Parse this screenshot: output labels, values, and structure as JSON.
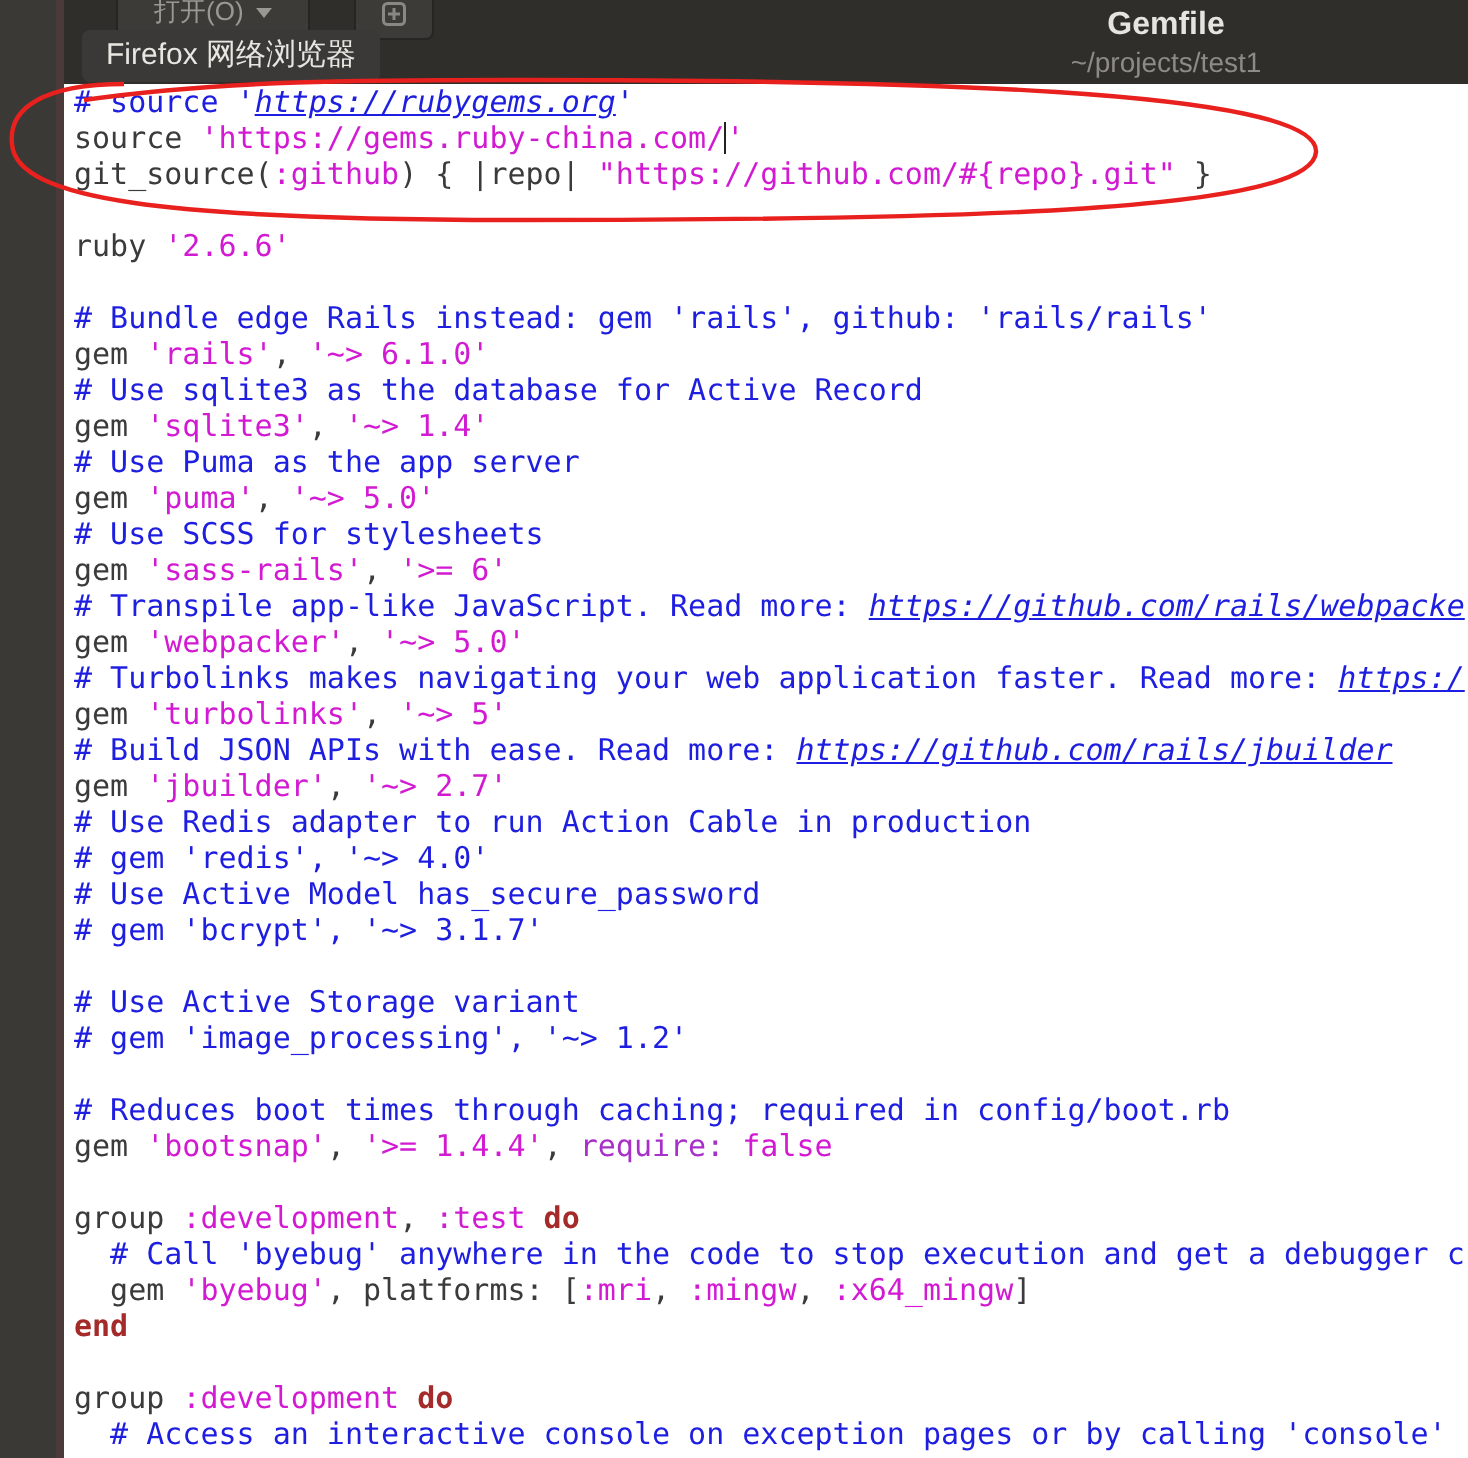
{
  "header": {
    "open_button": "打开(O)",
    "title": "Gemfile",
    "subtitle": "~/projects/test1"
  },
  "tooltip": "Firefox 网络浏览器",
  "lines": [
    {
      "kind": "code",
      "tokens": [
        {
          "kind": "comment",
          "text": "# source '"
        },
        {
          "kind": "link",
          "text": "https://rubygems.org"
        },
        {
          "kind": "comment",
          "text": "'"
        }
      ]
    },
    {
      "kind": "code",
      "tokens": [
        {
          "kind": "plain",
          "text": "source "
        },
        {
          "kind": "string",
          "text": "'https://gems.ruby-china.com/"
        },
        {
          "kind": "cursor"
        },
        {
          "kind": "string",
          "text": "'"
        }
      ]
    },
    {
      "kind": "code",
      "tokens": [
        {
          "kind": "plain",
          "text": "git_source("
        },
        {
          "kind": "symbol",
          "text": ":github"
        },
        {
          "kind": "plain",
          "text": ") { |repo| "
        },
        {
          "kind": "string",
          "text": "\"https://github.com/#{repo}.git\""
        },
        {
          "kind": "plain",
          "text": " }"
        }
      ]
    },
    {
      "kind": "blank"
    },
    {
      "kind": "code",
      "tokens": [
        {
          "kind": "plain",
          "text": "ruby "
        },
        {
          "kind": "string",
          "text": "'2.6.6'"
        }
      ]
    },
    {
      "kind": "blank"
    },
    {
      "kind": "code",
      "tokens": [
        {
          "kind": "comment",
          "text": "# Bundle edge Rails instead: gem 'rails', github: 'rails/rails'"
        }
      ]
    },
    {
      "kind": "code",
      "tokens": [
        {
          "kind": "plain",
          "text": "gem "
        },
        {
          "kind": "string",
          "text": "'rails'"
        },
        {
          "kind": "plain",
          "text": ", "
        },
        {
          "kind": "string",
          "text": "'~> 6.1.0'"
        }
      ]
    },
    {
      "kind": "code",
      "tokens": [
        {
          "kind": "comment",
          "text": "# Use sqlite3 as the database for Active Record"
        }
      ]
    },
    {
      "kind": "code",
      "tokens": [
        {
          "kind": "plain",
          "text": "gem "
        },
        {
          "kind": "string",
          "text": "'sqlite3'"
        },
        {
          "kind": "plain",
          "text": ", "
        },
        {
          "kind": "string",
          "text": "'~> 1.4'"
        }
      ]
    },
    {
      "kind": "code",
      "tokens": [
        {
          "kind": "comment",
          "text": "# Use Puma as the app server"
        }
      ]
    },
    {
      "kind": "code",
      "tokens": [
        {
          "kind": "plain",
          "text": "gem "
        },
        {
          "kind": "string",
          "text": "'puma'"
        },
        {
          "kind": "plain",
          "text": ", "
        },
        {
          "kind": "string",
          "text": "'~> 5.0'"
        }
      ]
    },
    {
      "kind": "code",
      "tokens": [
        {
          "kind": "comment",
          "text": "# Use SCSS for stylesheets"
        }
      ]
    },
    {
      "kind": "code",
      "tokens": [
        {
          "kind": "plain",
          "text": "gem "
        },
        {
          "kind": "string",
          "text": "'sass-rails'"
        },
        {
          "kind": "plain",
          "text": ", "
        },
        {
          "kind": "string",
          "text": "'>= 6'"
        }
      ]
    },
    {
      "kind": "code",
      "tokens": [
        {
          "kind": "comment",
          "text": "# Transpile app-like JavaScript. Read more: "
        },
        {
          "kind": "link",
          "text": "https://github.com/rails/webpacke"
        }
      ]
    },
    {
      "kind": "code",
      "tokens": [
        {
          "kind": "plain",
          "text": "gem "
        },
        {
          "kind": "string",
          "text": "'webpacker'"
        },
        {
          "kind": "plain",
          "text": ", "
        },
        {
          "kind": "string",
          "text": "'~> 5.0'"
        }
      ]
    },
    {
      "kind": "code",
      "tokens": [
        {
          "kind": "comment",
          "text": "# Turbolinks makes navigating your web application faster. Read more: "
        },
        {
          "kind": "link",
          "text": "https:/"
        }
      ]
    },
    {
      "kind": "code",
      "tokens": [
        {
          "kind": "plain",
          "text": "gem "
        },
        {
          "kind": "string",
          "text": "'turbolinks'"
        },
        {
          "kind": "plain",
          "text": ", "
        },
        {
          "kind": "string",
          "text": "'~> 5'"
        }
      ]
    },
    {
      "kind": "code",
      "tokens": [
        {
          "kind": "comment",
          "text": "# Build JSON APIs with ease. Read more: "
        },
        {
          "kind": "link",
          "text": "https://github.com/rails/jbuilder"
        }
      ]
    },
    {
      "kind": "code",
      "tokens": [
        {
          "kind": "plain",
          "text": "gem "
        },
        {
          "kind": "string",
          "text": "'jbuilder'"
        },
        {
          "kind": "plain",
          "text": ", "
        },
        {
          "kind": "string",
          "text": "'~> 2.7'"
        }
      ]
    },
    {
      "kind": "code",
      "tokens": [
        {
          "kind": "comment",
          "text": "# Use Redis adapter to run Action Cable in production"
        }
      ]
    },
    {
      "kind": "code",
      "tokens": [
        {
          "kind": "comment",
          "text": "# gem 'redis', '~> 4.0'"
        }
      ]
    },
    {
      "kind": "code",
      "tokens": [
        {
          "kind": "comment",
          "text": "# Use Active Model has_secure_password"
        }
      ]
    },
    {
      "kind": "code",
      "tokens": [
        {
          "kind": "comment",
          "text": "# gem 'bcrypt', '~> 3.1.7'"
        }
      ]
    },
    {
      "kind": "blank"
    },
    {
      "kind": "code",
      "tokens": [
        {
          "kind": "comment",
          "text": "# Use Active Storage variant"
        }
      ]
    },
    {
      "kind": "code",
      "tokens": [
        {
          "kind": "comment",
          "text": "# gem 'image_processing', '~> 1.2'"
        }
      ]
    },
    {
      "kind": "blank"
    },
    {
      "kind": "code",
      "tokens": [
        {
          "kind": "comment",
          "text": "# Reduces boot times through caching; required in config/boot.rb"
        }
      ]
    },
    {
      "kind": "code",
      "tokens": [
        {
          "kind": "plain",
          "text": "gem "
        },
        {
          "kind": "string",
          "text": "'bootsnap'"
        },
        {
          "kind": "plain",
          "text": ", "
        },
        {
          "kind": "string",
          "text": "'>= 1.4.4'"
        },
        {
          "kind": "plain",
          "text": ", "
        },
        {
          "kind": "key",
          "text": "require: "
        },
        {
          "kind": "string",
          "text": "false"
        }
      ]
    },
    {
      "kind": "blank"
    },
    {
      "kind": "code",
      "tokens": [
        {
          "kind": "plain",
          "text": "group "
        },
        {
          "kind": "symbol",
          "text": ":development"
        },
        {
          "kind": "plain",
          "text": ", "
        },
        {
          "kind": "symbol",
          "text": ":test"
        },
        {
          "kind": "keyword",
          "text": " do"
        }
      ]
    },
    {
      "kind": "code",
      "tokens": [
        {
          "kind": "comment",
          "text": "  # Call 'byebug' anywhere in the code to stop execution and get a debugger c"
        }
      ]
    },
    {
      "kind": "code",
      "tokens": [
        {
          "kind": "plain",
          "text": "  gem "
        },
        {
          "kind": "string",
          "text": "'byebug'"
        },
        {
          "kind": "plain",
          "text": ", platforms: ["
        },
        {
          "kind": "symbol",
          "text": ":mri"
        },
        {
          "kind": "plain",
          "text": ", "
        },
        {
          "kind": "symbol",
          "text": ":mingw"
        },
        {
          "kind": "plain",
          "text": ", "
        },
        {
          "kind": "symbol",
          "text": ":x64_mingw"
        },
        {
          "kind": "plain",
          "text": "]"
        }
      ]
    },
    {
      "kind": "code",
      "tokens": [
        {
          "kind": "keyword",
          "text": "end"
        }
      ]
    },
    {
      "kind": "blank"
    },
    {
      "kind": "code",
      "tokens": [
        {
          "kind": "plain",
          "text": "group "
        },
        {
          "kind": "symbol",
          "text": ":development"
        },
        {
          "kind": "keyword",
          "text": " do"
        }
      ]
    },
    {
      "kind": "code",
      "tokens": [
        {
          "kind": "comment",
          "text": "  # Access an interactive console on exception pages or by calling 'console'"
        }
      ]
    }
  ]
}
